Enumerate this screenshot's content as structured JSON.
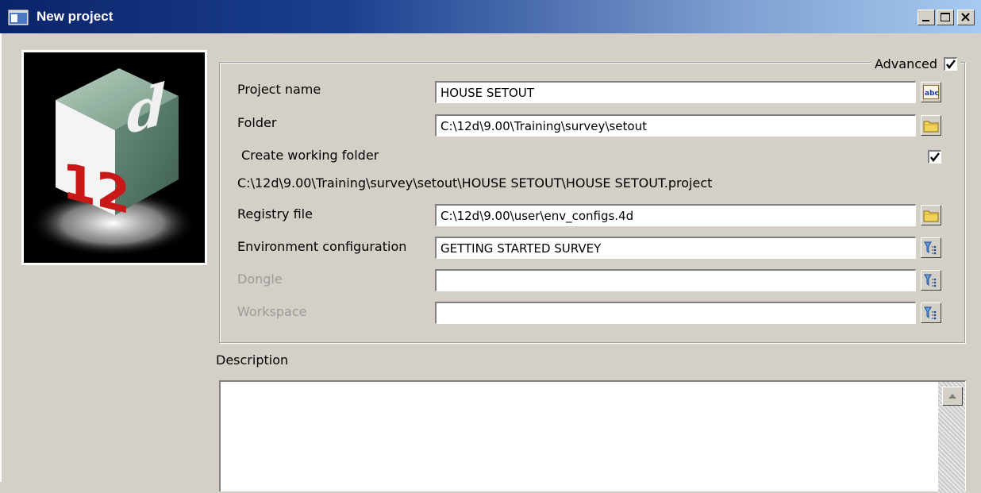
{
  "window": {
    "title": "New project",
    "minimize_label": "_",
    "maximize_label": "□",
    "close_label": "✕"
  },
  "logo": {
    "text_12": "12",
    "text_d": "d"
  },
  "advanced": {
    "label": "Advanced",
    "checked": true
  },
  "form": {
    "project_name": {
      "label": "Project name",
      "value": "HOUSE SETOUT",
      "button_icon": "abc-icon"
    },
    "folder": {
      "label": "Folder",
      "value": "C:\\12d\\9.00\\Training\\survey\\setout",
      "button_icon": "folder-icon"
    },
    "create_working_folder": {
      "label": "Create working folder",
      "checked": true
    },
    "project_path": "C:\\12d\\9.00\\Training\\survey\\setout\\HOUSE SETOUT\\HOUSE SETOUT.project",
    "registry_file": {
      "label": "Registry file",
      "value": "C:\\12d\\9.00\\user\\env_configs.4d",
      "button_icon": "folder-icon"
    },
    "environment_configuration": {
      "label": "Environment configuration",
      "value": "GETTING STARTED SURVEY",
      "button_icon": "tree-list-icon"
    },
    "dongle": {
      "label": "Dongle",
      "value": "",
      "button_icon": "tree-list-icon"
    },
    "workspace": {
      "label": "Workspace",
      "value": "",
      "button_icon": "tree-list-icon"
    }
  },
  "description": {
    "label": "Description",
    "value": ""
  },
  "colors": {
    "titlebar_start": "#0a246a",
    "titlebar_end": "#a6caf0",
    "dialog_bg": "#d4d0c8",
    "disabled_text": "#9a9a9a"
  }
}
